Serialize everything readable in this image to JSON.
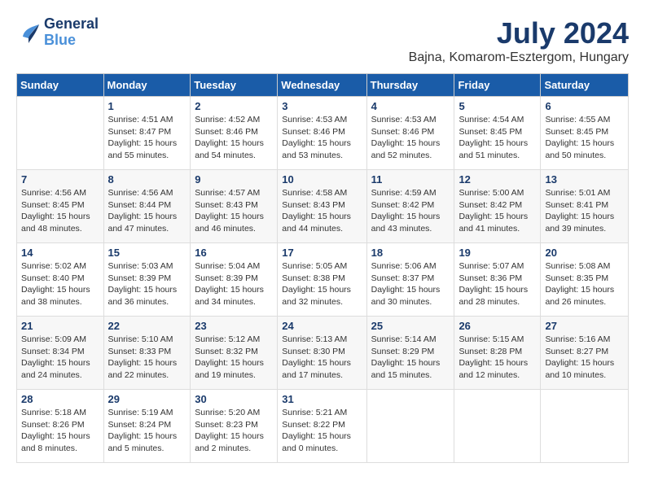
{
  "logo": {
    "line1": "General",
    "line2": "Blue"
  },
  "title": "July 2024",
  "subtitle": "Bajna, Komarom-Esztergom, Hungary",
  "headers": [
    "Sunday",
    "Monday",
    "Tuesday",
    "Wednesday",
    "Thursday",
    "Friday",
    "Saturday"
  ],
  "weeks": [
    [
      {
        "day": "",
        "info": ""
      },
      {
        "day": "1",
        "info": "Sunrise: 4:51 AM\nSunset: 8:47 PM\nDaylight: 15 hours\nand 55 minutes."
      },
      {
        "day": "2",
        "info": "Sunrise: 4:52 AM\nSunset: 8:46 PM\nDaylight: 15 hours\nand 54 minutes."
      },
      {
        "day": "3",
        "info": "Sunrise: 4:53 AM\nSunset: 8:46 PM\nDaylight: 15 hours\nand 53 minutes."
      },
      {
        "day": "4",
        "info": "Sunrise: 4:53 AM\nSunset: 8:46 PM\nDaylight: 15 hours\nand 52 minutes."
      },
      {
        "day": "5",
        "info": "Sunrise: 4:54 AM\nSunset: 8:45 PM\nDaylight: 15 hours\nand 51 minutes."
      },
      {
        "day": "6",
        "info": "Sunrise: 4:55 AM\nSunset: 8:45 PM\nDaylight: 15 hours\nand 50 minutes."
      }
    ],
    [
      {
        "day": "7",
        "info": "Sunrise: 4:56 AM\nSunset: 8:45 PM\nDaylight: 15 hours\nand 48 minutes."
      },
      {
        "day": "8",
        "info": "Sunrise: 4:56 AM\nSunset: 8:44 PM\nDaylight: 15 hours\nand 47 minutes."
      },
      {
        "day": "9",
        "info": "Sunrise: 4:57 AM\nSunset: 8:43 PM\nDaylight: 15 hours\nand 46 minutes."
      },
      {
        "day": "10",
        "info": "Sunrise: 4:58 AM\nSunset: 8:43 PM\nDaylight: 15 hours\nand 44 minutes."
      },
      {
        "day": "11",
        "info": "Sunrise: 4:59 AM\nSunset: 8:42 PM\nDaylight: 15 hours\nand 43 minutes."
      },
      {
        "day": "12",
        "info": "Sunrise: 5:00 AM\nSunset: 8:42 PM\nDaylight: 15 hours\nand 41 minutes."
      },
      {
        "day": "13",
        "info": "Sunrise: 5:01 AM\nSunset: 8:41 PM\nDaylight: 15 hours\nand 39 minutes."
      }
    ],
    [
      {
        "day": "14",
        "info": "Sunrise: 5:02 AM\nSunset: 8:40 PM\nDaylight: 15 hours\nand 38 minutes."
      },
      {
        "day": "15",
        "info": "Sunrise: 5:03 AM\nSunset: 8:39 PM\nDaylight: 15 hours\nand 36 minutes."
      },
      {
        "day": "16",
        "info": "Sunrise: 5:04 AM\nSunset: 8:39 PM\nDaylight: 15 hours\nand 34 minutes."
      },
      {
        "day": "17",
        "info": "Sunrise: 5:05 AM\nSunset: 8:38 PM\nDaylight: 15 hours\nand 32 minutes."
      },
      {
        "day": "18",
        "info": "Sunrise: 5:06 AM\nSunset: 8:37 PM\nDaylight: 15 hours\nand 30 minutes."
      },
      {
        "day": "19",
        "info": "Sunrise: 5:07 AM\nSunset: 8:36 PM\nDaylight: 15 hours\nand 28 minutes."
      },
      {
        "day": "20",
        "info": "Sunrise: 5:08 AM\nSunset: 8:35 PM\nDaylight: 15 hours\nand 26 minutes."
      }
    ],
    [
      {
        "day": "21",
        "info": "Sunrise: 5:09 AM\nSunset: 8:34 PM\nDaylight: 15 hours\nand 24 minutes."
      },
      {
        "day": "22",
        "info": "Sunrise: 5:10 AM\nSunset: 8:33 PM\nDaylight: 15 hours\nand 22 minutes."
      },
      {
        "day": "23",
        "info": "Sunrise: 5:12 AM\nSunset: 8:32 PM\nDaylight: 15 hours\nand 19 minutes."
      },
      {
        "day": "24",
        "info": "Sunrise: 5:13 AM\nSunset: 8:30 PM\nDaylight: 15 hours\nand 17 minutes."
      },
      {
        "day": "25",
        "info": "Sunrise: 5:14 AM\nSunset: 8:29 PM\nDaylight: 15 hours\nand 15 minutes."
      },
      {
        "day": "26",
        "info": "Sunrise: 5:15 AM\nSunset: 8:28 PM\nDaylight: 15 hours\nand 12 minutes."
      },
      {
        "day": "27",
        "info": "Sunrise: 5:16 AM\nSunset: 8:27 PM\nDaylight: 15 hours\nand 10 minutes."
      }
    ],
    [
      {
        "day": "28",
        "info": "Sunrise: 5:18 AM\nSunset: 8:26 PM\nDaylight: 15 hours\nand 8 minutes."
      },
      {
        "day": "29",
        "info": "Sunrise: 5:19 AM\nSunset: 8:24 PM\nDaylight: 15 hours\nand 5 minutes."
      },
      {
        "day": "30",
        "info": "Sunrise: 5:20 AM\nSunset: 8:23 PM\nDaylight: 15 hours\nand 2 minutes."
      },
      {
        "day": "31",
        "info": "Sunrise: 5:21 AM\nSunset: 8:22 PM\nDaylight: 15 hours\nand 0 minutes."
      },
      {
        "day": "",
        "info": ""
      },
      {
        "day": "",
        "info": ""
      },
      {
        "day": "",
        "info": ""
      }
    ]
  ]
}
